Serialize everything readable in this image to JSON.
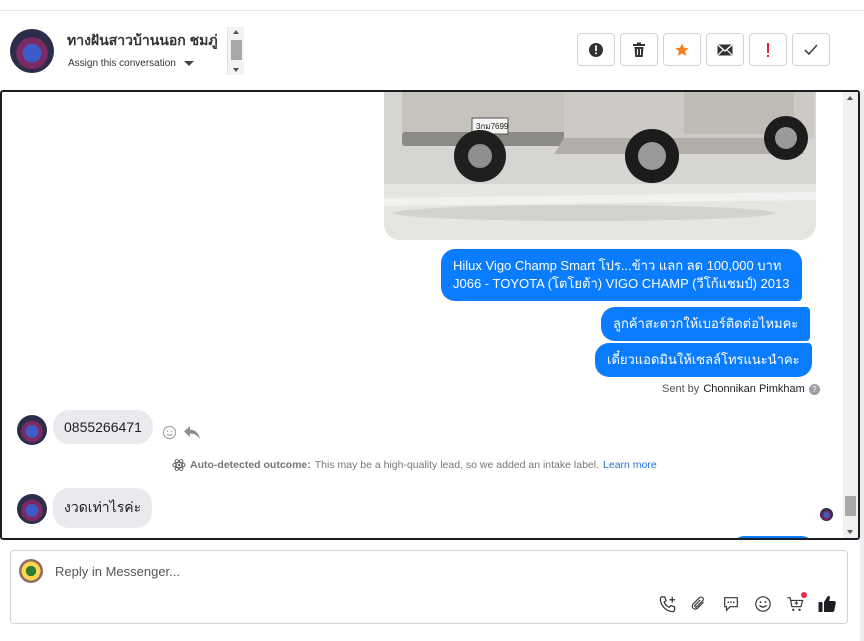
{
  "header": {
    "contact_name": "ทางฝันสาวบ้านนอก ชมภู่",
    "assign_label": "Assign this conversation",
    "actions": [
      {
        "icon": "alert-circle-icon",
        "name": "mark-spam-button"
      },
      {
        "icon": "trash-icon",
        "name": "delete-button"
      },
      {
        "icon": "star-icon",
        "name": "star-button",
        "color": "#f5821f"
      },
      {
        "icon": "envelope-icon",
        "name": "mark-unread-button"
      },
      {
        "icon": "exclamation-icon",
        "name": "follow-up-button",
        "color": "#e41e3f"
      },
      {
        "icon": "check-icon",
        "name": "mark-done-button"
      }
    ]
  },
  "thread": {
    "out_messages": [
      "Hilux Vigo Champ Smart โปร...ข้าว แลก ลด 100,000 บาท",
      "J066 - TOYOTA (โตโยต้า) VIGO CHAMP (วีโก้แชมป์) 2013",
      "ลูกค้าสะดวกให้เบอร์ติดต่อไหมคะ",
      "เดี๋ยวแอดมินให้เซลล์โทรแนะนำคะ"
    ],
    "sent_by_prefix": "Sent by",
    "sent_by_name": "Chonnikan Pimkham",
    "in_messages": [
      "0855266471",
      "งวดเท่าไรค่ะ"
    ],
    "outcome_label": "Auto-detected outcome:",
    "outcome_text": "This may be a high-quality lead, so we added an intake label.",
    "outcome_link": "Learn more",
    "plate_text": "3กม7699"
  },
  "reply": {
    "placeholder": "Reply in Messenger..."
  },
  "colors": {
    "accent": "#0a7cff",
    "star": "#f5821f",
    "alert": "#e41e3f"
  }
}
